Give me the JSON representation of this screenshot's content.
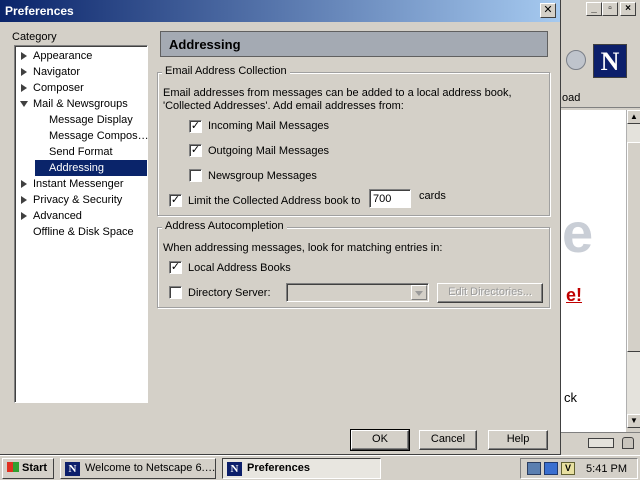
{
  "dialog": {
    "title": "Preferences",
    "category_label": "Category",
    "tree": [
      {
        "label": "Appearance",
        "level": 0,
        "twisty": "closed"
      },
      {
        "label": "Navigator",
        "level": 0,
        "twisty": "closed"
      },
      {
        "label": "Composer",
        "level": 0,
        "twisty": "closed"
      },
      {
        "label": "Mail & Newsgroups",
        "level": 0,
        "twisty": "open"
      },
      {
        "label": "Message Display",
        "level": 1,
        "twisty": "none"
      },
      {
        "label": "Message Compos…",
        "level": 1,
        "twisty": "none"
      },
      {
        "label": "Send Format",
        "level": 1,
        "twisty": "none"
      },
      {
        "label": "Addressing",
        "level": 1,
        "twisty": "none",
        "selected": true
      },
      {
        "label": "Instant Messenger",
        "level": 0,
        "twisty": "closed"
      },
      {
        "label": "Privacy & Security",
        "level": 0,
        "twisty": "closed"
      },
      {
        "label": "Advanced",
        "level": 0,
        "twisty": "closed"
      },
      {
        "label": "Offline & Disk Space",
        "level": 0,
        "twisty": "none"
      }
    ],
    "panel_title": "Addressing",
    "collection": {
      "legend": "Email Address Collection",
      "desc_line1": "Email addresses from messages can be added to a local address book,",
      "desc_line2": "'Collected Addresses'. Add email addresses from:",
      "incoming": {
        "label": "Incoming Mail Messages",
        "checked": true
      },
      "outgoing": {
        "label": "Outgoing Mail Messages",
        "checked": true
      },
      "newsgroup": {
        "label": "Newsgroup Messages",
        "checked": false
      },
      "limit": {
        "label": "Limit the Collected Address book to",
        "checked": true,
        "value": "700",
        "suffix": "cards"
      }
    },
    "autocompletion": {
      "legend": "Address Autocompletion",
      "desc": "When addressing messages, look for matching entries in:",
      "local": {
        "label": "Local Address Books",
        "checked": true
      },
      "directory": {
        "label": "Directory Server:",
        "checked": false,
        "value": ""
      },
      "edit_directories": "Edit Directories..."
    },
    "buttons": {
      "ok": "OK",
      "cancel": "Cancel",
      "help": "Help"
    }
  },
  "background_window": {
    "logo_letter": "N",
    "toolbar_text": "oad",
    "big_letter": "e",
    "red_text": "e!",
    "lower_text": "ck"
  },
  "taskbar": {
    "start": "Start",
    "tasks": [
      {
        "label": "Welcome to Netscape 6.…",
        "active": false
      },
      {
        "label": "Preferences",
        "active": true
      }
    ],
    "clock": "5:41 PM"
  },
  "colors": {
    "titlebar": "#0a246a",
    "selection": "#0a246a",
    "face": "#d4d0c8",
    "header": "#a4aab3"
  }
}
